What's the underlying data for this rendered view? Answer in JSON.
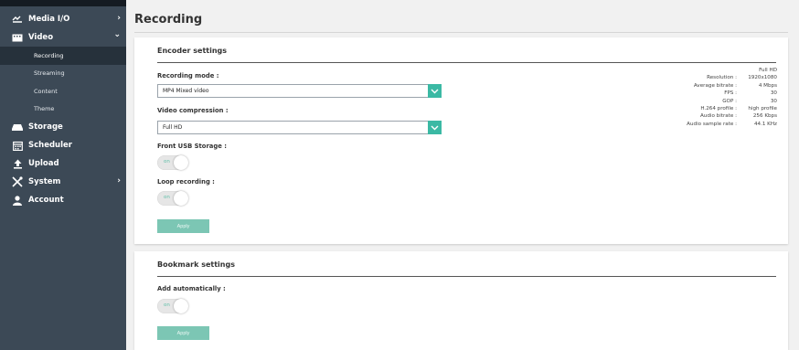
{
  "sidebar": {
    "items": [
      {
        "label": "Media I/O",
        "icon": "media-io-icon",
        "chevron": "›"
      },
      {
        "label": "Video",
        "icon": "video-icon",
        "chevron": "⌄"
      },
      {
        "label": "Storage",
        "icon": "storage-icon"
      },
      {
        "label": "Scheduler",
        "icon": "calendar-icon"
      },
      {
        "label": "Upload",
        "icon": "upload-icon"
      },
      {
        "label": "System",
        "icon": "tools-icon",
        "chevron": "›"
      },
      {
        "label": "Account",
        "icon": "user-icon"
      }
    ],
    "video_subitems": [
      "Recording",
      "Streaming",
      "Content",
      "Theme"
    ]
  },
  "page": {
    "title": "Recording"
  },
  "encoder": {
    "heading": "Encoder settings",
    "recording_mode": {
      "label": "Recording mode :",
      "value": "MP4 Mixed video"
    },
    "video_compression": {
      "label": "Video compression :",
      "value": "Full HD"
    },
    "front_usb": {
      "label": "Front USB Storage :",
      "state": "on"
    },
    "loop_recording": {
      "label": "Loop recording :",
      "state": "on"
    },
    "apply_label": "Apply",
    "info": {
      "preset": "Full HD",
      "rows": [
        {
          "key": "Resolution :",
          "value": "1920x1080"
        },
        {
          "key": "Average bitrate :",
          "value": "4 Mbps"
        },
        {
          "key": "FPS :",
          "value": "30"
        },
        {
          "key": "GOP :",
          "value": "30"
        },
        {
          "key": "H.264 profile :",
          "value": "high profile"
        },
        {
          "key": "Audio bitrate :",
          "value": "256 Kbps"
        },
        {
          "key": "Audio sample rate :",
          "value": "44.1 KHz"
        }
      ]
    }
  },
  "bookmark": {
    "heading": "Bookmark settings",
    "add_auto": {
      "label": "Add automatically :",
      "state": "on"
    },
    "apply_label": "Apply"
  },
  "colors": {
    "sidebar": "#3c4956",
    "sidebar_active": "#26313b",
    "accent": "#3bb9a4",
    "apply": "#7cc6b4"
  }
}
